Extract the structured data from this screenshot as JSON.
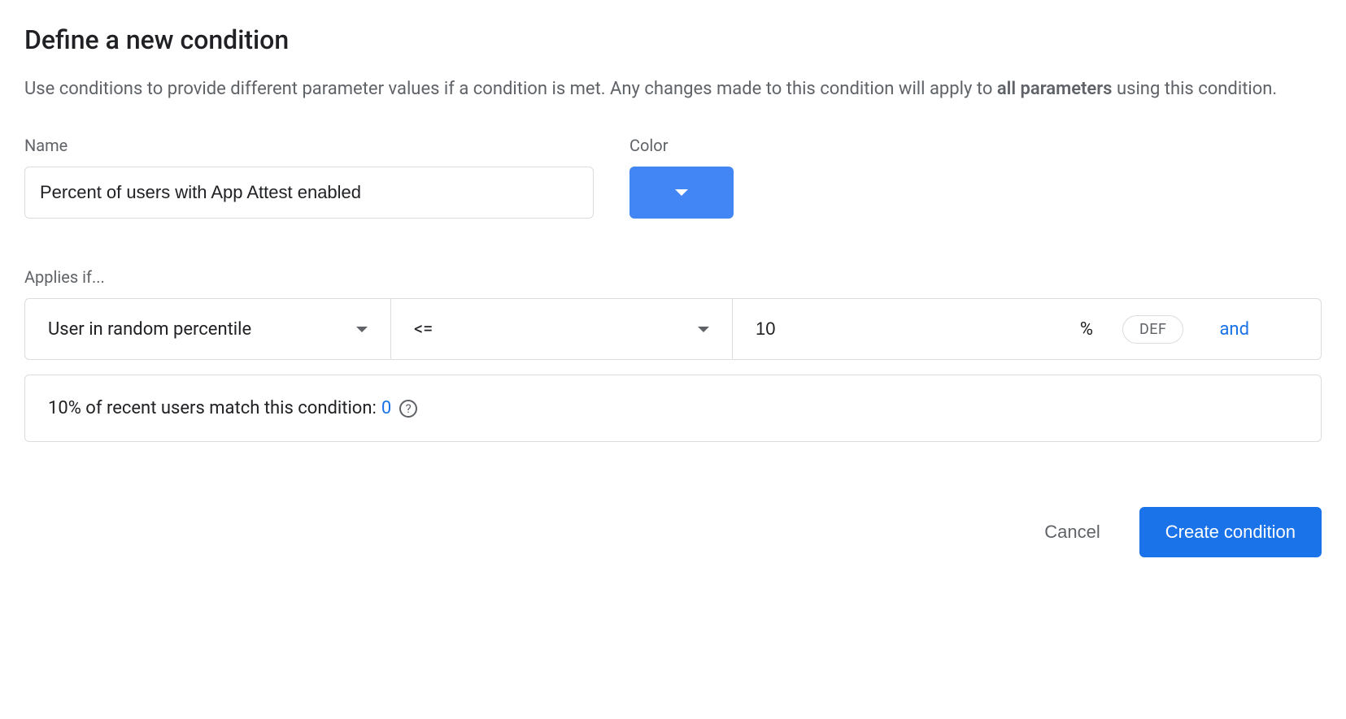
{
  "title": "Define a new condition",
  "description": {
    "prefix": "Use conditions to provide different parameter values if a condition is met. Any changes made to this condition will apply to ",
    "bold": "all parameters",
    "suffix": " using this condition."
  },
  "fields": {
    "name_label": "Name",
    "name_value": "Percent of users with App Attest enabled",
    "color_label": "Color",
    "color_value": "#4285f4"
  },
  "applies": {
    "label": "Applies if...",
    "condition_type": "User in random percentile",
    "operator": "<=",
    "value": "10",
    "unit": "%",
    "def_label": "DEF",
    "and_label": "and"
  },
  "match": {
    "text": "10% of recent users match this condition: ",
    "count": "0"
  },
  "actions": {
    "cancel": "Cancel",
    "create": "Create condition"
  }
}
